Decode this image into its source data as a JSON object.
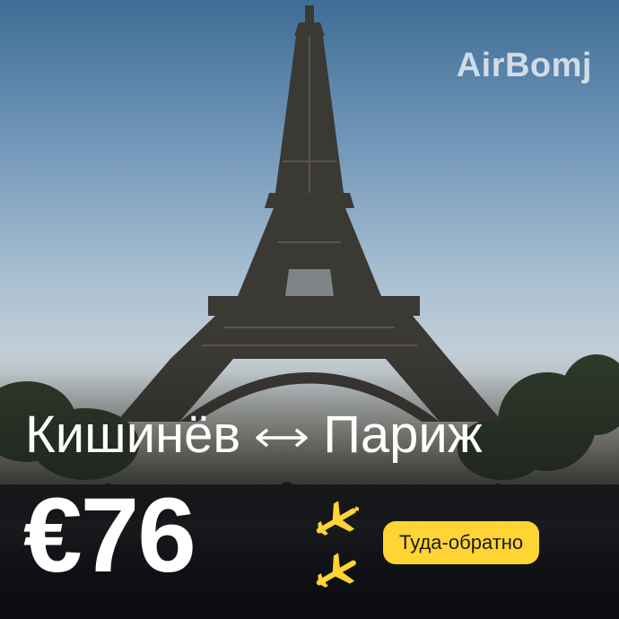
{
  "brand": {
    "name": "AirBomj"
  },
  "route": {
    "from": "Кишинёв",
    "to": "Париж",
    "direction_icon": "round-trip-arrow-icon"
  },
  "offer": {
    "price": "€76",
    "trip_type": "Туда-обратно",
    "flight_icon": "airplane-icon"
  },
  "photo": {
    "subject_icon": "eiffel-tower-illustration"
  },
  "colors": {
    "accent": "#ffd433",
    "text": "#ffffff",
    "sky_top": "#3f6d96",
    "tower": "#3b3934"
  }
}
